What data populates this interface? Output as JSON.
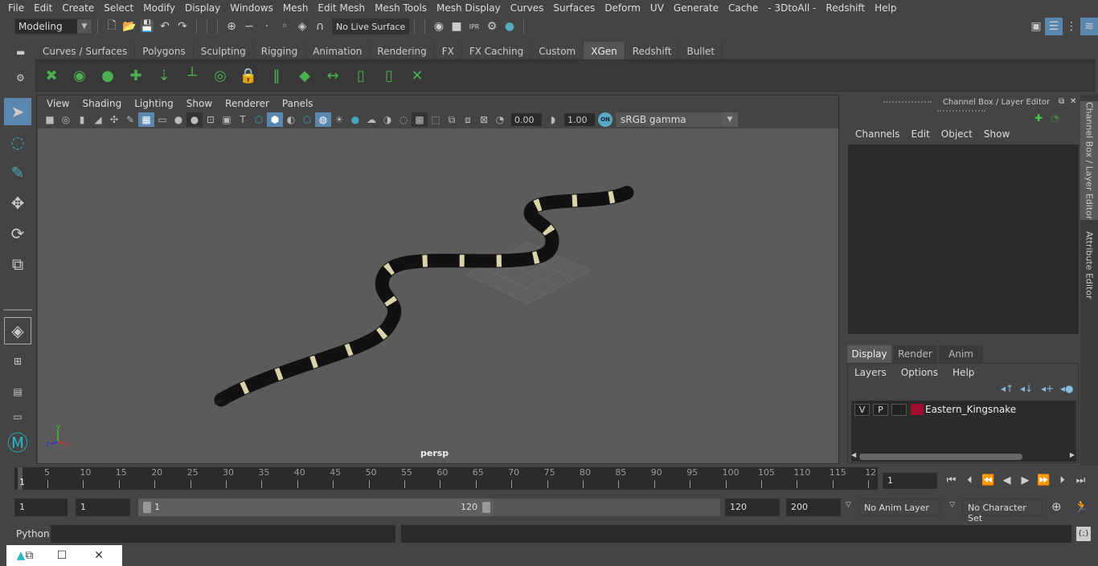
{
  "menubar": [
    "File",
    "Edit",
    "Create",
    "Select",
    "Modify",
    "Display",
    "Windows",
    "Mesh",
    "Edit Mesh",
    "Mesh Tools",
    "Mesh Display",
    "Curves",
    "Surfaces",
    "Deform",
    "UV",
    "Generate",
    "Cache",
    "- 3DtoAll -",
    "Redshift",
    "Help"
  ],
  "status_line": {
    "workspace": "Modeling",
    "live_surface": "No Live Surface"
  },
  "shelf": {
    "tabs": [
      "Curves / Surfaces",
      "Polygons",
      "Sculpting",
      "Rigging",
      "Animation",
      "Rendering",
      "FX",
      "FX Caching",
      "Custom",
      "XGen",
      "Redshift",
      "Bullet"
    ],
    "active_tab": "XGen",
    "icons": [
      "xgen-create-description-icon",
      "xgen-preview-icon",
      "xgen-clear-preview-icon",
      "xgen-add-guides-icon",
      "xgen-place-guides-icon",
      "xgen-add-guide-icon",
      "xgen-guide-visibility-icon",
      "xgen-lock-guides-icon",
      "xgen-split-guides-icon",
      "xgen-groom-layers-icon",
      "xgen-sculpt-icon",
      "xgen-select-region-icon",
      "xgen-region-icon",
      "xgen-delete-guides-icon"
    ]
  },
  "viewport": {
    "menu": [
      "View",
      "Shading",
      "Lighting",
      "Show",
      "Renderer",
      "Panels"
    ],
    "exposure": "0.00",
    "gamma": "1.00",
    "color_space": "sRGB gamma",
    "camera_label": "persp",
    "axis": {
      "x": "x",
      "y": "y",
      "z": "z"
    }
  },
  "channel_box": {
    "title": "Channel Box / Layer Editor",
    "menu": [
      "Channels",
      "Edit",
      "Object",
      "Show"
    ],
    "layer_tabs": [
      "Display",
      "Render",
      "Anim"
    ],
    "active_layer_tab": "Display",
    "layer_menu": [
      "Layers",
      "Options",
      "Help"
    ],
    "layers": [
      {
        "v": "V",
        "p": "P",
        "color": "#a0102e",
        "name": "Eastern_Kingsnake"
      }
    ]
  },
  "side_tabs": [
    "Channel Box / Layer Editor",
    "Attribute Editor"
  ],
  "timeline": {
    "labels": [
      "5",
      "10",
      "15",
      "20",
      "25",
      "30",
      "35",
      "40",
      "45",
      "50",
      "55",
      "60",
      "65",
      "70",
      "75",
      "80",
      "85",
      "90",
      "95",
      "100",
      "105",
      "110",
      "115",
      "12"
    ],
    "current_marker": "1",
    "current_frame": "1"
  },
  "range": {
    "start": "1",
    "playback_start": "1",
    "slider_start": "1",
    "slider_end": "120",
    "playback_end": "120",
    "end": "200",
    "anim_layer": "No Anim Layer",
    "character_set": "No Character Set"
  },
  "command_line": {
    "label": "Python"
  }
}
